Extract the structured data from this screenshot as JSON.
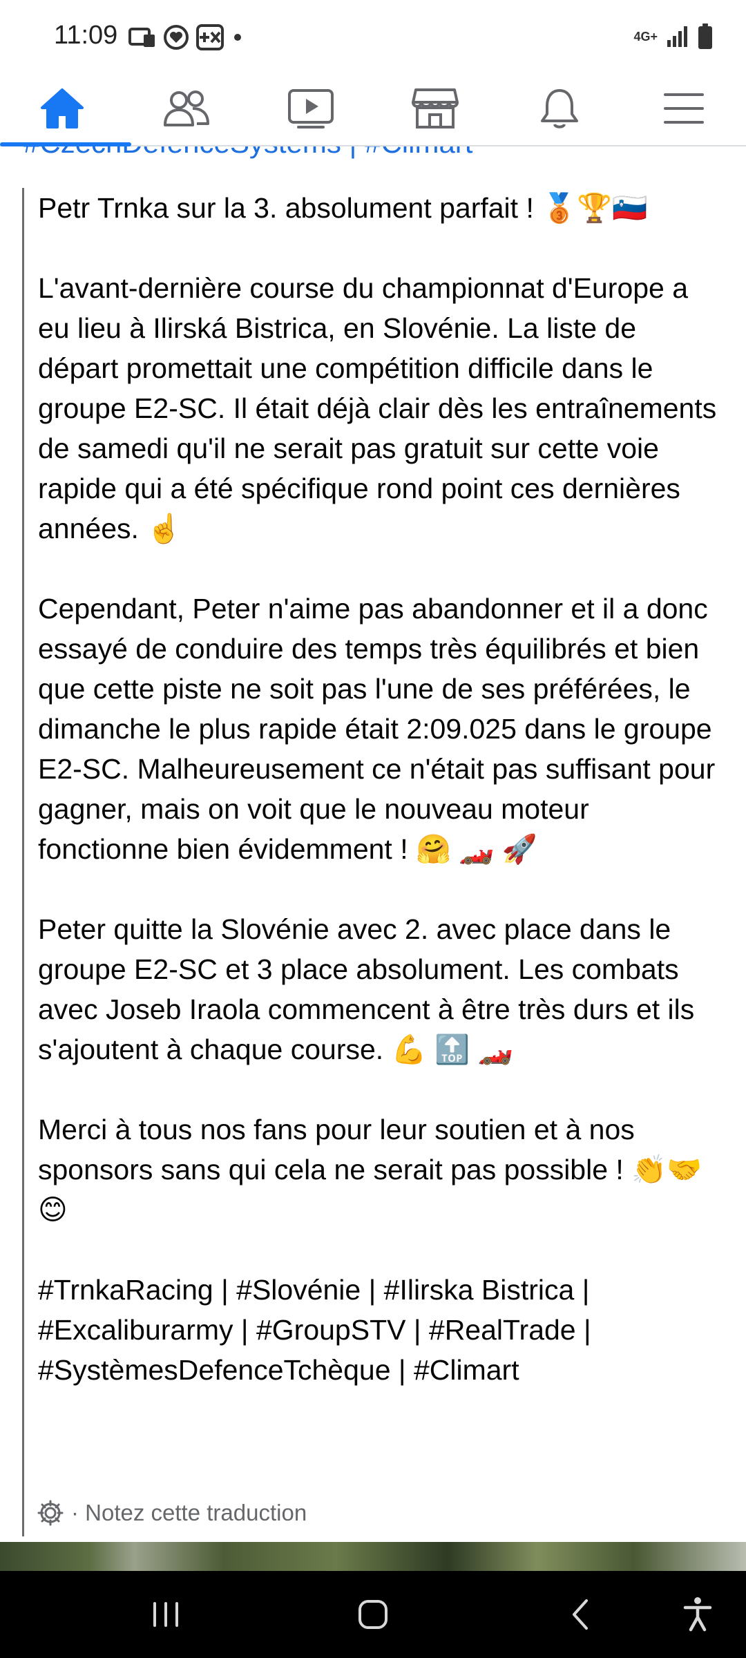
{
  "status_bar": {
    "time": "11:09",
    "network": "4G+",
    "icons": [
      "message-icon",
      "heart-notification-icon",
      "plus-x-icon",
      "dot-icon",
      "signal-icon",
      "battery-icon"
    ]
  },
  "nav": {
    "active_color": "#1877f2",
    "items": [
      {
        "name": "home",
        "icon": "home-icon",
        "active": true
      },
      {
        "name": "friends",
        "icon": "friends-icon"
      },
      {
        "name": "watch",
        "icon": "video-icon"
      },
      {
        "name": "marketplace",
        "icon": "store-icon"
      },
      {
        "name": "notifications",
        "icon": "bell-icon"
      },
      {
        "name": "menu",
        "icon": "hamburger-icon"
      }
    ]
  },
  "clipped_hashtags": "#CzechDefenceSystems | #Climart",
  "post": {
    "p1": "Petr Trnka sur la 3. absolument parfait ! 🥉🏆🇸🇮",
    "p2": "L'avant-dernière course du championnat d'Europe a eu lieu à Ilirská Bistrica, en Slovénie. La liste de départ promettait une compétition difficile dans le groupe E2-SC. Il était déjà clair dès les entraînements de samedi qu'il ne serait pas gratuit sur cette voie rapide qui a été spécifique rond point ces dernières années.  ☝️",
    "p3": "Cependant, Peter n'aime pas abandonner et il a donc essayé de conduire des temps très équilibrés et bien que cette piste ne soit pas l'une de ses préférées, le dimanche le plus rapide était 2:09.025 dans le groupe E2-SC. Malheureusement ce n'était pas suffisant pour gagner, mais on voit que le nouveau moteur fonctionne bien évidemment ! 🤗 🏎️ 🚀",
    "p4": "Peter quitte la Slovénie avec 2. avec place dans le groupe E2-SC et 3 place absolument. Les combats avec Joseb Iraola commencent à être très durs et ils s'ajoutent à chaque course. 💪 🔝 🏎️",
    "p5": "Merci à tous nos fans pour leur soutien et à nos sponsors sans qui cela ne serait pas possible ! 👏🤝😊",
    "hashtags": "#TrnkaRacing | #Slovénie | #Ilirska Bistrica | #Excaliburarmy | #GroupSTV | #RealTrade | #SystèmesDefenceTchèque | #Climart",
    "translation_label": "· Notez cette traduction"
  },
  "system_nav": {
    "buttons": [
      "recent-apps-icon",
      "home-circle-icon",
      "back-icon",
      "accessibility-icon"
    ]
  }
}
